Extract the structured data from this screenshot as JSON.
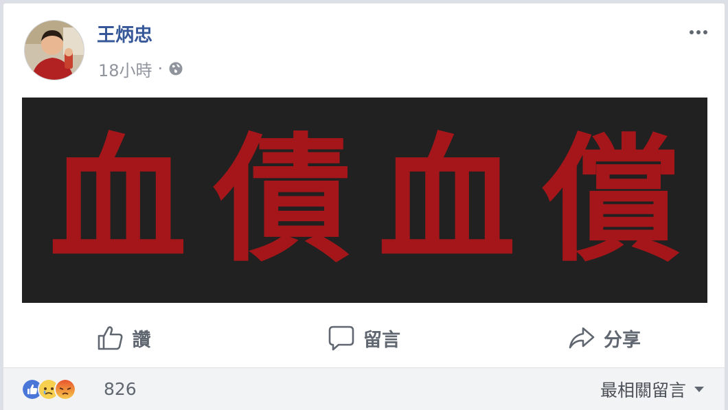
{
  "post": {
    "author": "王炳忠",
    "time": "18小時",
    "separator": "·",
    "privacy_icon": "globe-icon"
  },
  "banner": {
    "chars": [
      "血",
      "債",
      "血",
      "償"
    ],
    "text_color": "#a4161a",
    "background": "#212121"
  },
  "actions": {
    "like": "讚",
    "comment": "留言",
    "share": "分享"
  },
  "reactions": {
    "icons": [
      "like-reaction-icon",
      "sad-reaction-icon",
      "angry-reaction-icon"
    ],
    "count": "826"
  },
  "sort": {
    "label": "最相關留言"
  },
  "colors": {
    "author_link": "#365899",
    "meta_text": "#90949c",
    "action_text": "#606770"
  }
}
